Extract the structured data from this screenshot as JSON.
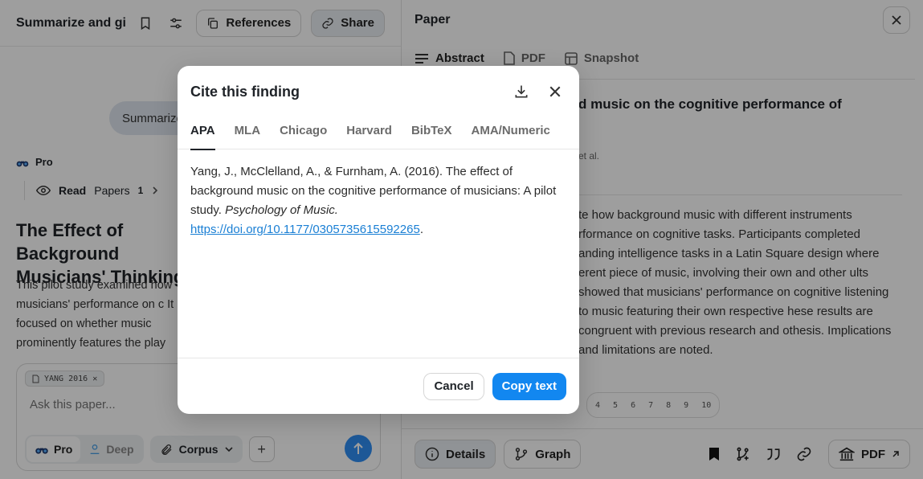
{
  "left": {
    "chat_title": "Summarize and giv",
    "references_label": "References",
    "share_label": "Share",
    "query_text": "Summarize",
    "pro_label": "Pro",
    "steps": {
      "read": "Read",
      "papers": "Papers",
      "count": "1"
    },
    "answer_title": "The Effect of Background Musicians' Thinking",
    "answer_body": "This pilot study examined how musicians' performance on c It focused on whether music prominently features the play",
    "composer": {
      "chip": "YANG 2016",
      "placeholder": "Ask this paper...",
      "mode_pro": "Pro",
      "mode_deep": "Deep",
      "corpus": "Corpus"
    }
  },
  "right": {
    "title": "Paper",
    "tabs": [
      "Abstract",
      "PDF",
      "Snapshot"
    ],
    "paper_title": "d music on the cognitive performance of",
    "authors": "et al.",
    "abstract": "te how background music with different instruments rformance on cognitive tasks. Participants completed anding intelligence tasks in a Latin Square design where erent piece of music, involving their own and other ults showed that musicians' performance on cognitive listening to music featuring their own respective hese results are congruent with previous research and othesis. Implications and limitations are noted.",
    "pages": [
      "4",
      "5",
      "6",
      "7",
      "8",
      "9",
      "10"
    ],
    "bottom": {
      "details": "Details",
      "graph": "Graph",
      "pdf": "PDF"
    }
  },
  "modal": {
    "title": "Cite this finding",
    "tabs": [
      "APA",
      "MLA",
      "Chicago",
      "Harvard",
      "BibTeX",
      "AMA/Numeric"
    ],
    "citation": {
      "text": "Yang, J., McClelland, A., & Furnham, A. (2016). The effect of background music on the cognitive performance of musicians: A pilot study. ",
      "journal": "Psychology of Music.",
      "doi": "https://doi.org/10.1177/0305735615592265",
      "after_doi": "."
    },
    "cancel_label": "Cancel",
    "copy_label": "Copy text"
  },
  "colors": {
    "accent": "#1287f0",
    "overlay": "rgba(0,0,0,0.38)"
  }
}
